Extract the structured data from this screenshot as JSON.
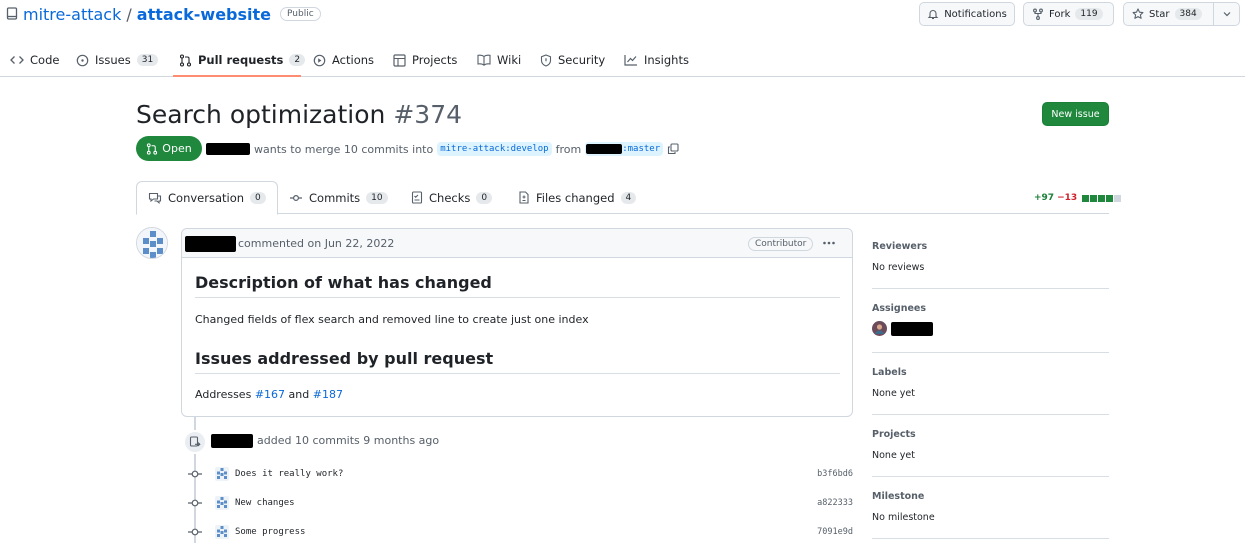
{
  "repo": {
    "owner": "mitre-attack",
    "separator": "/",
    "name": "attack-website",
    "visibility": "Public"
  },
  "actions": {
    "notifications": "Notifications",
    "fork_label": "Fork",
    "fork_count": "119",
    "star_label": "Star",
    "star_count": "384"
  },
  "nav": {
    "code": "Code",
    "issues": "Issues",
    "issues_count": "31",
    "pulls": "Pull requests",
    "pulls_count": "2",
    "actions": "Actions",
    "projects": "Projects",
    "wiki": "Wiki",
    "security": "Security",
    "insights": "Insights"
  },
  "pr": {
    "title": "Search optimization",
    "number": "#374",
    "state": "Open",
    "merge_text": "wants to merge 10 commits into",
    "base_branch": "mitre-attack:develop",
    "from_text": "from",
    "head_branch_suffix": ":master",
    "new_issue": "New issue"
  },
  "tabs": {
    "conversation": "Conversation",
    "conversation_count": "0",
    "commits": "Commits",
    "commits_count": "10",
    "checks": "Checks",
    "checks_count": "0",
    "files": "Files changed",
    "files_count": "4",
    "additions": "+97",
    "deletions": "−13"
  },
  "comment": {
    "header_text": "commented on Jun 22, 2022",
    "role": "Contributor",
    "h_description": "Description of what has changed",
    "description": "Changed fields of flex search and removed line to create just one index",
    "h_issues": "Issues addressed by pull request",
    "addresses": "Addresses",
    "issue_a": "#167",
    "and": "and",
    "issue_b": "#187"
  },
  "timeline": {
    "added_text": "added 10 commits 9 months ago",
    "commits": [
      {
        "message": "Does it really work?",
        "sha": "b3f6bd6"
      },
      {
        "message": "New changes",
        "sha": "a822333"
      },
      {
        "message": "Some progress",
        "sha": "7091e9d"
      }
    ]
  },
  "sidebar": {
    "reviewers_h": "Reviewers",
    "reviewers_v": "No reviews",
    "assignees_h": "Assignees",
    "labels_h": "Labels",
    "labels_v": "None yet",
    "projects_h": "Projects",
    "projects_v": "None yet",
    "milestone_h": "Milestone",
    "milestone_v": "No milestone"
  },
  "colors": {
    "open_green": "#1f883d",
    "link_blue": "#0969da",
    "tab_underline": "#fd8c73",
    "addition": "#1a7f37",
    "deletion": "#cf222e"
  },
  "icons": [
    "repo-icon",
    "bell-icon",
    "fork-icon",
    "star-icon",
    "code-icon",
    "issue-icon",
    "pull-request-icon",
    "play-icon",
    "table-icon",
    "book-icon",
    "shield-icon",
    "graph-icon",
    "copy-icon",
    "comment-icon",
    "commit-icon",
    "checklist-icon",
    "file-diff-icon",
    "kebab-icon",
    "repo-push-icon"
  ]
}
